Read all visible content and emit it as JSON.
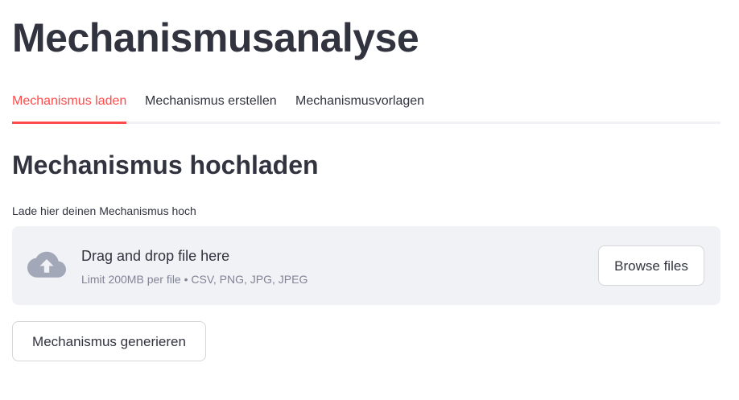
{
  "page": {
    "title": "Mechanismusanalyse"
  },
  "tabs": [
    {
      "label": "Mechanismus laden",
      "active": true
    },
    {
      "label": "Mechanismus erstellen",
      "active": false
    },
    {
      "label": "Mechanismusvorlagen",
      "active": false
    }
  ],
  "section": {
    "title": "Mechanismus hochladen"
  },
  "uploader": {
    "label": "Lade hier deinen Mechanismus hoch",
    "icon": "cloud-upload-icon",
    "main_text": "Drag and drop file here",
    "sub_text": "Limit 200MB per file • CSV, PNG, JPG, JPEG",
    "browse_label": "Browse files"
  },
  "actions": {
    "generate_label": "Mechanismus generieren"
  },
  "colors": {
    "accent": "#ff4b4b",
    "text": "#31333f",
    "muted": "#808495",
    "dropzone_bg": "#f0f2f6",
    "icon": "#a3a8b8"
  }
}
